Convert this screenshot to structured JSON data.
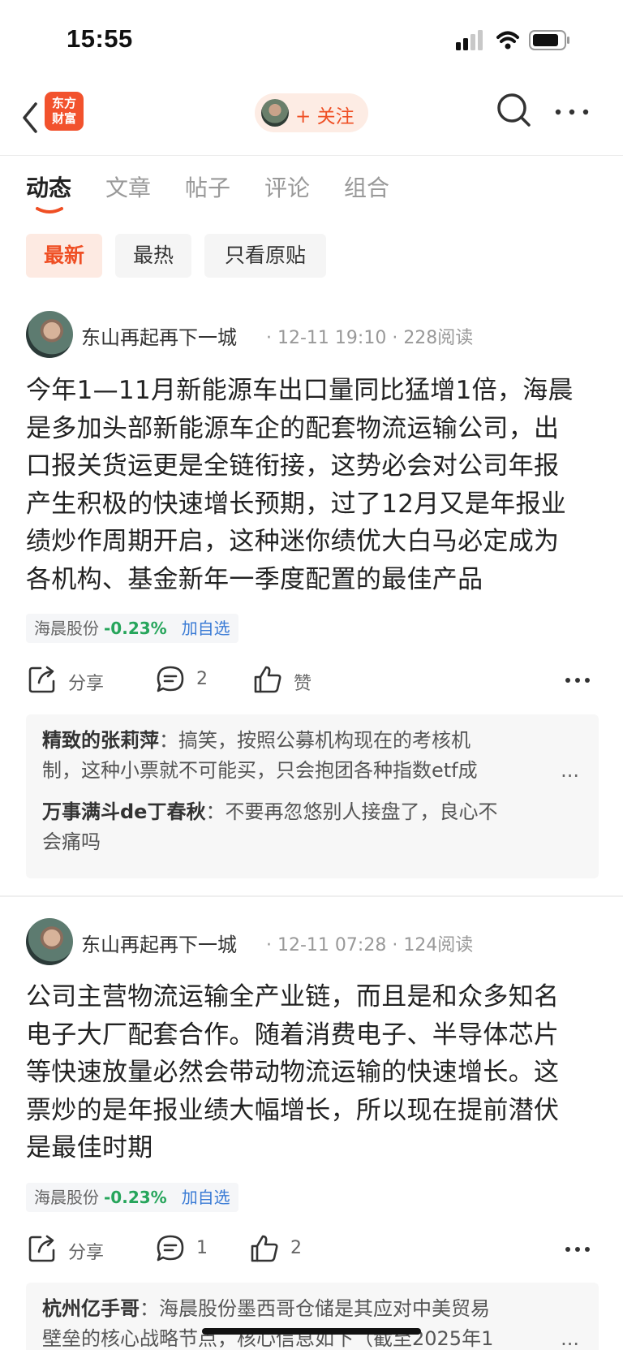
{
  "status_bar": {
    "time": "15:55"
  },
  "nav": {
    "logo_line1": "东方",
    "logo_line2": "财富",
    "follow_label": "+ 关注"
  },
  "tabs": [
    {
      "label": "动态"
    },
    {
      "label": "文章"
    },
    {
      "label": "帖子"
    },
    {
      "label": "评论"
    },
    {
      "label": "组合"
    }
  ],
  "filters": [
    {
      "label": "最新"
    },
    {
      "label": "最热"
    },
    {
      "label": "只看原贴"
    }
  ],
  "posts": [
    {
      "author": "东山再起再下一城",
      "time": "12-11 19:10",
      "reads": "228阅读",
      "content_lines": [
        "今年1—11月新能源车出口量同比猛增1倍，海晨",
        "是多加头部新能源车企的配套物流运输公司，出",
        "口报关货运更是全链衔接，这势必会对公司年报",
        "产生积极的快速增长预期，过了12月又是年报业",
        "绩炒作周期开启，这种迷你绩优大白马必定成为",
        "各机构、基金新年一季度配置的最佳产品"
      ],
      "stock": {
        "name": "海晨股份",
        "change": "-0.23%",
        "add": "加自选"
      },
      "actions": {
        "share": "分享",
        "comments": "2",
        "like": "赞"
      },
      "comments": [
        {
          "who": "精致的张莉萍",
          "text": "：搞笑，按照公募机构现在的考核机",
          "text2": "制，这种小票就不可能买，只会抱团各种指数etf成",
          "more": "..."
        },
        {
          "who": "万事满斗de丁春秋",
          "text": "：不要再忽悠别人接盘了，良心不",
          "text2": "会痛吗"
        }
      ]
    },
    {
      "author": "东山再起再下一城",
      "time": "12-11 07:28",
      "reads": "124阅读",
      "content_lines": [
        "公司主营物流运输全产业链，而且是和众多知名",
        "电子大厂配套合作。随着消费电子、半导体芯片",
        "等快速放量必然会带动物流运输的快速增长。这",
        "票炒的是年报业绩大幅增长，所以现在提前潜伏",
        "是最佳时期"
      ],
      "stock": {
        "name": "海晨股份",
        "change": "-0.23%",
        "add": "加自选"
      },
      "actions": {
        "share": "分享",
        "comments": "1",
        "like": "2"
      },
      "comments": [
        {
          "who": "杭州亿手哥",
          "text": "：海晨股份墨西哥仓储是其应对中美贸易",
          "text2": "壁垒的核心战略节点，核心信息如下（截至2025年1",
          "more": "..."
        }
      ]
    }
  ]
}
